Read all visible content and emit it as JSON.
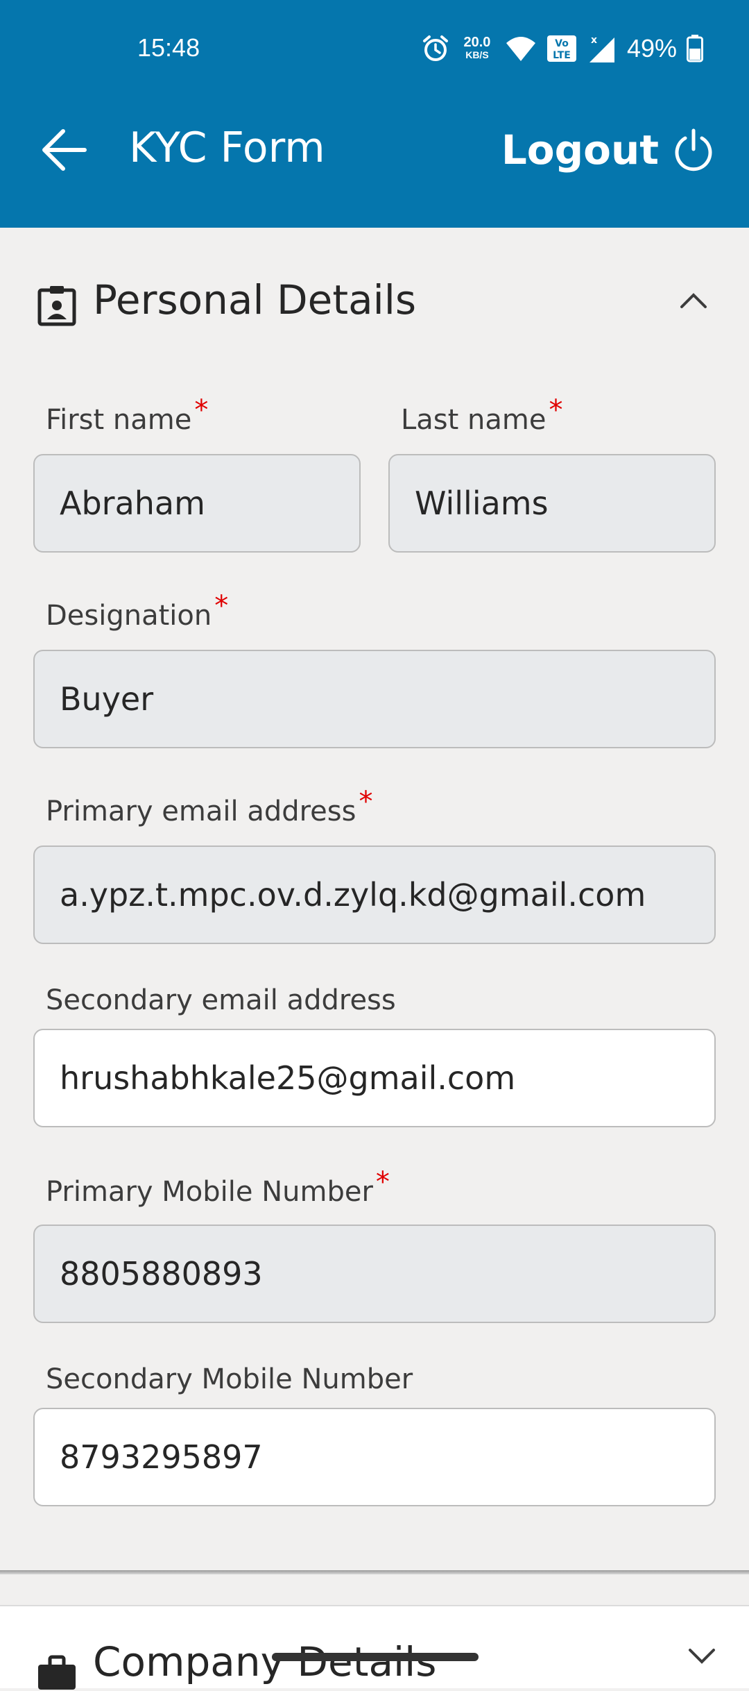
{
  "status_bar": {
    "time": "15:48",
    "net_speed_value": "20.0",
    "net_speed_unit": "KB/S",
    "battery": "49%",
    "icons": [
      "alarm-icon",
      "wifi-icon",
      "volte-icon",
      "signal-icon",
      "battery-icon"
    ]
  },
  "toolbar": {
    "title": "KYC Form",
    "logout_label": "Logout",
    "back_icon": "arrow-left-icon",
    "logout_icon": "power-icon"
  },
  "personal_section": {
    "title": "Personal Details",
    "required_mark": "*",
    "fields": {
      "first_name": {
        "label": "First name",
        "value": "Abraham"
      },
      "last_name": {
        "label": "Last name",
        "value": "Williams"
      },
      "designation": {
        "label": "Designation",
        "value": "Buyer"
      },
      "primary_email": {
        "label": "Primary email address",
        "value": "a.ypz.t.mpc.ov.d.zylq.kd@gmail.com"
      },
      "secondary_email": {
        "label": "Secondary email address",
        "value": "hrushabhkale25@gmail.com"
      },
      "primary_mobile": {
        "label": "Primary Mobile Number",
        "value": "8805880893"
      },
      "secondary_mobile": {
        "label": "Secondary Mobile Number",
        "value": "8793295897"
      }
    }
  },
  "company_section": {
    "title": "Company Details"
  },
  "colors": {
    "app_bar": "#0576ad",
    "background": "#f1f0ef",
    "disabled_field": "#e8eaec",
    "editable_field": "#ffffff",
    "required": "#e00000"
  }
}
